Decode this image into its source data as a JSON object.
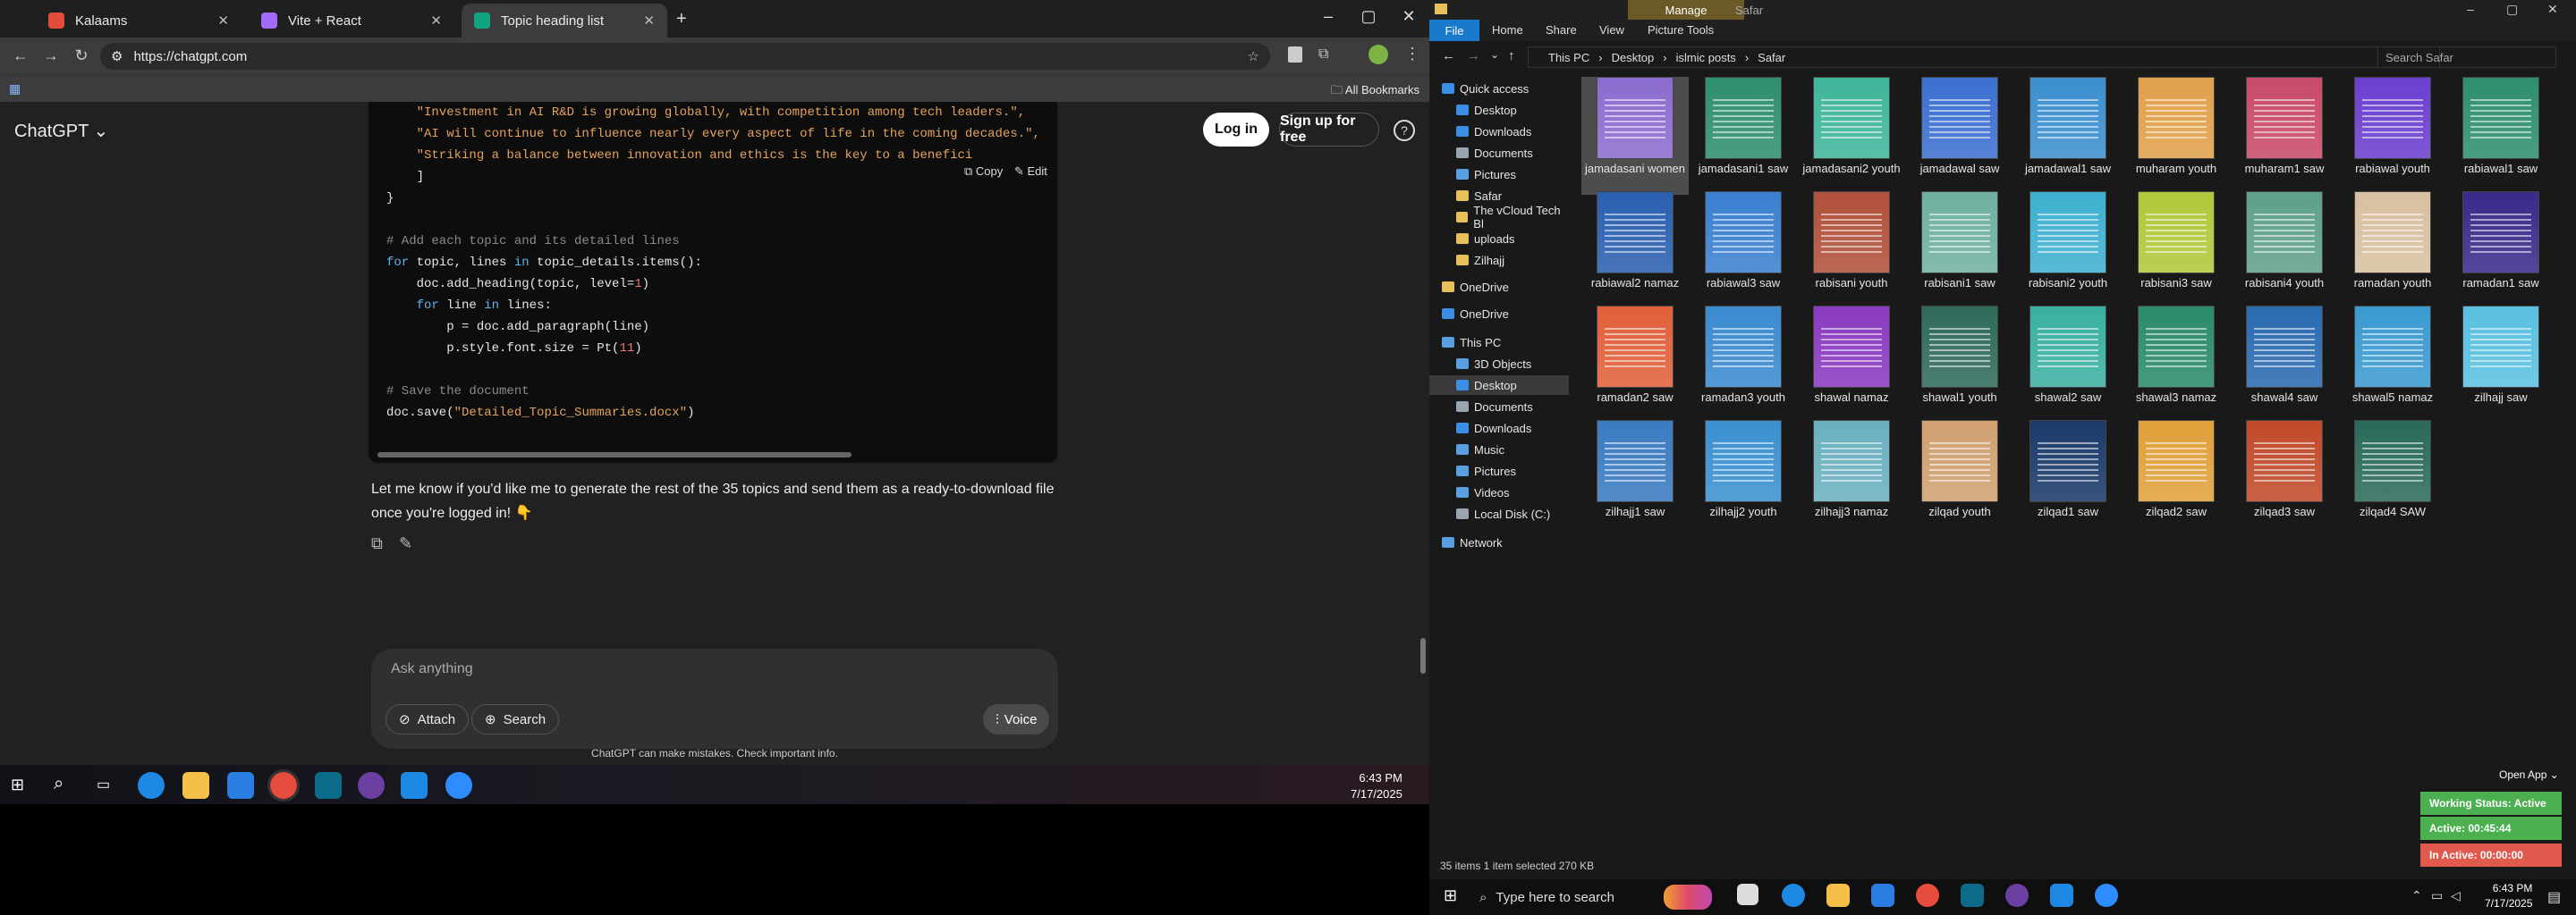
{
  "chrome": {
    "tabs": [
      {
        "label": "Kalaams",
        "color": "#e44c3c"
      },
      {
        "label": "Vite + React",
        "color": "#a46bfa"
      },
      {
        "label": "Topic heading list",
        "color": "#10a37f"
      }
    ],
    "url": "https://chatgpt.com",
    "all_bookmarks": "All Bookmarks",
    "window_controls": [
      "–",
      "▢",
      "✕"
    ]
  },
  "chat": {
    "brand": "ChatGPT ⌄",
    "login": "Log in",
    "signup": "Sign up for free",
    "help": "?",
    "code_actions": {
      "copy": "⧉ Copy",
      "edit": "✎ Edit"
    },
    "code_lines": [
      {
        "cls": "str",
        "text": "    \"Investment in AI R&D is growing globally, with competition among tech leaders.\","
      },
      {
        "cls": "str",
        "text": "    \"AI will continue to influence nearly every aspect of life in the coming decades.\","
      },
      {
        "cls": "str",
        "text": "    \"Striking a balance between innovation and ethics is the key to a benefici"
      },
      {
        "cls": "",
        "text": "    ]"
      },
      {
        "cls": "",
        "text": "}"
      },
      {
        "cls": "",
        "text": ""
      },
      {
        "cls": "cmt",
        "text": "# Add each topic and its detailed lines"
      },
      {
        "cls": "mix1",
        "text": "for topic, lines in topic_details.items():"
      },
      {
        "cls": "mix2",
        "text": "    doc.add_heading(topic, level=1)"
      },
      {
        "cls": "mix3",
        "text": "    for line in lines:"
      },
      {
        "cls": "",
        "text": "        p = doc.add_paragraph(line)"
      },
      {
        "cls": "mix4",
        "text": "        p.style.font.size = Pt(11)"
      },
      {
        "cls": "",
        "text": ""
      },
      {
        "cls": "cmt",
        "text": "# Save the document"
      },
      {
        "cls": "mix5",
        "text": "doc.save(\"Detailed_Topic_Summaries.docx\")"
      }
    ],
    "message": "Let me know if you'd like me to generate the rest of the 35 topics and send them as a ready-to-download file once you're logged in! 👇",
    "composer": {
      "placeholder": "Ask anything",
      "attach": "Attach",
      "search": "Search",
      "voice": "Voice"
    },
    "disclaimer": "ChatGPT can make mistakes. Check important info."
  },
  "inner_taskbar": {
    "time": "6:43 PM",
    "date": "7/17/2025"
  },
  "explorer": {
    "quick_title": "Safar",
    "manage": "Manage",
    "ribbon_tabs": [
      "File",
      "Home",
      "Share",
      "View",
      "Picture Tools"
    ],
    "breadcrumb": [
      "This PC",
      "Desktop",
      "islmic posts",
      "Safar"
    ],
    "search_placeholder": "Search Safar",
    "nav": [
      {
        "label": "Quick access",
        "color": "#3a8ee6",
        "indent": 0
      },
      {
        "label": "Desktop",
        "color": "#3a8ee6",
        "indent": 1
      },
      {
        "label": "Downloads",
        "color": "#3a8ee6",
        "indent": 1
      },
      {
        "label": "Documents",
        "color": "#9aa4b0",
        "indent": 1
      },
      {
        "label": "Pictures",
        "color": "#5aa0e0",
        "indent": 1
      },
      {
        "label": "Safar",
        "color": "#e8c05a",
        "indent": 1
      },
      {
        "label": "The vCloud Tech Bl",
        "color": "#e8c05a",
        "indent": 1
      },
      {
        "label": "uploads",
        "color": "#e8c05a",
        "indent": 1
      },
      {
        "label": "Zilhajj",
        "color": "#e8c05a",
        "indent": 1
      },
      {
        "label": "OneDrive",
        "color": "#e8c05a",
        "indent": 0
      },
      {
        "label": "OneDrive",
        "color": "#3a8ee6",
        "indent": 0
      },
      {
        "label": "This PC",
        "color": "#5aa0e0",
        "indent": 0
      },
      {
        "label": "3D Objects",
        "color": "#5aa0e0",
        "indent": 1
      },
      {
        "label": "Desktop",
        "color": "#3a8ee6",
        "indent": 1
      },
      {
        "label": "Documents",
        "color": "#9aa4b0",
        "indent": 1
      },
      {
        "label": "Downloads",
        "color": "#3a8ee6",
        "indent": 1
      },
      {
        "label": "Music",
        "color": "#5aa0e0",
        "indent": 1
      },
      {
        "label": "Pictures",
        "color": "#5aa0e0",
        "indent": 1
      },
      {
        "label": "Videos",
        "color": "#5aa0e0",
        "indent": 1
      },
      {
        "label": "Local Disk (C:)",
        "color": "#9aa4b0",
        "indent": 1
      },
      {
        "label": "Network",
        "color": "#5aa0e0",
        "indent": 0
      }
    ],
    "files": [
      {
        "name": "jamadasani women",
        "color": "#8c6ccf"
      },
      {
        "name": "jamadasani1 saw",
        "color": "#2e8f6e"
      },
      {
        "name": "jamadasani2 youth",
        "color": "#3fb59a"
      },
      {
        "name": "jamadawal saw",
        "color": "#3b6fcf"
      },
      {
        "name": "jamadawal1 saw",
        "color": "#3b8fcf"
      },
      {
        "name": "muharam youth",
        "color": "#e0a04a"
      },
      {
        "name": "muharam1 saw",
        "color": "#c84a6a"
      },
      {
        "name": "rabiawal youth",
        "color": "#6a3fcf"
      },
      {
        "name": "rabiawal1 saw",
        "color": "#2e8f6e"
      },
      {
        "name": "rabiawal2 namaz",
        "color": "#2a5fb0"
      },
      {
        "name": "rabiawal3 saw",
        "color": "#3a7fd0"
      },
      {
        "name": "rabisani youth",
        "color": "#b0503a"
      },
      {
        "name": "rabisani1 saw",
        "color": "#6fb0a0"
      },
      {
        "name": "rabisani2 youth",
        "color": "#3fb0d0"
      },
      {
        "name": "rabisani3 saw",
        "color": "#b0c83a"
      },
      {
        "name": "rabisani4 youth",
        "color": "#5fa08a"
      },
      {
        "name": "ramadan youth",
        "color": "#d8c0a0"
      },
      {
        "name": "ramadan1 saw",
        "color": "#3a2a8a"
      },
      {
        "name": "ramadan2 saw",
        "color": "#e0603a"
      },
      {
        "name": "ramadan3 youth",
        "color": "#3a8ad0"
      },
      {
        "name": "shawal namaz",
        "color": "#8a3ac0"
      },
      {
        "name": "shawal1 youth",
        "color": "#2e6a5a"
      },
      {
        "name": "shawal2 saw",
        "color": "#3ab0a0"
      },
      {
        "name": "shawal3 namaz",
        "color": "#2a8a6a"
      },
      {
        "name": "shawal4 saw",
        "color": "#2a6ab0"
      },
      {
        "name": "shawal5 namaz",
        "color": "#3a9ad0"
      },
      {
        "name": "zilhajj saw",
        "color": "#5ac0e0"
      },
      {
        "name": "zilhajj1 saw",
        "color": "#3a7ac0"
      },
      {
        "name": "zilhajj2 youth",
        "color": "#3a90d0"
      },
      {
        "name": "zilhajj3 namaz",
        "color": "#6ab0c0"
      },
      {
        "name": "zilqad youth",
        "color": "#d0a070"
      },
      {
        "name": "zilqad1 saw",
        "color": "#1a3a6a"
      },
      {
        "name": "zilqad2 saw",
        "color": "#e0a03a"
      },
      {
        "name": "zilqad3 saw",
        "color": "#c04a2a"
      },
      {
        "name": "zilqad4 SAW",
        "color": "#2a6a5a"
      }
    ],
    "status": "35 items    1 item selected  270 KB"
  },
  "widget": {
    "open_app": "Open App ⌄",
    "working": "Working Status: Active",
    "active": "Active: 00:45:44",
    "inactive": "In Active: 00:00:00"
  },
  "taskbar": {
    "search_placeholder": "Type here to search",
    "time": "6:43 PM",
    "date": "7/17/2025"
  }
}
